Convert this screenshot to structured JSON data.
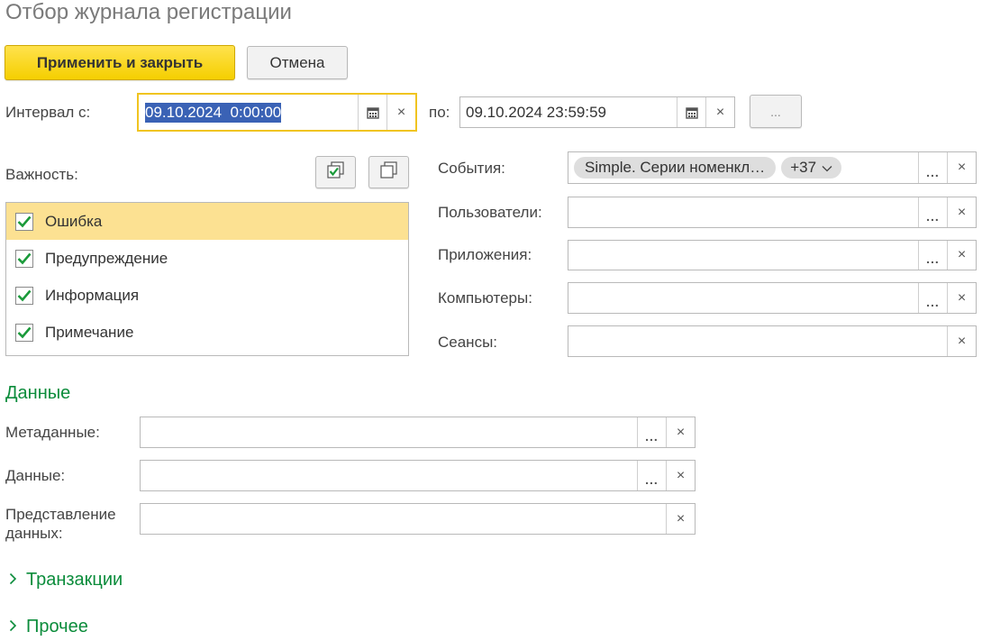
{
  "window": {
    "title": "Отбор журнала регистрации"
  },
  "toolbar": {
    "apply_label": "Применить и закрыть",
    "cancel_label": "Отмена"
  },
  "interval": {
    "from_label": "Интервал с:",
    "from_value": "09.10.2024  0:00:00",
    "to_label": "по:",
    "to_value": "09.10.2024 23:59:59",
    "period_button_label": "..."
  },
  "importance": {
    "label": "Важность:",
    "items": [
      {
        "label": "Ошибка",
        "checked": true,
        "selected": true
      },
      {
        "label": "Предупреждение",
        "checked": true,
        "selected": false
      },
      {
        "label": "Информация",
        "checked": true,
        "selected": false
      },
      {
        "label": "Примечание",
        "checked": true,
        "selected": false
      }
    ]
  },
  "filters": {
    "events_label": "События:",
    "events_chip": "Simple. Серии номенкл…",
    "events_more": "+37",
    "users_label": "Пользователи:",
    "apps_label": "Приложения:",
    "computers_label": "Компьютеры:",
    "sessions_label": "Сеансы:"
  },
  "data_section": {
    "title": "Данные",
    "metadata_label": "Метаданные:",
    "data_label": "Данные:",
    "presentation_label_1": "Представление",
    "presentation_label_2": "данных:"
  },
  "collapsed_sections": {
    "transactions": "Транзакции",
    "other": "Прочее"
  },
  "common": {
    "dots": "...",
    "clear": "×",
    "chevron": "›"
  },
  "colors": {
    "accent_green": "#0b8c3b",
    "primary_yellow": "#f5cf00",
    "selection_blue": "#3a62b5",
    "row_highlight": "#fce192"
  }
}
